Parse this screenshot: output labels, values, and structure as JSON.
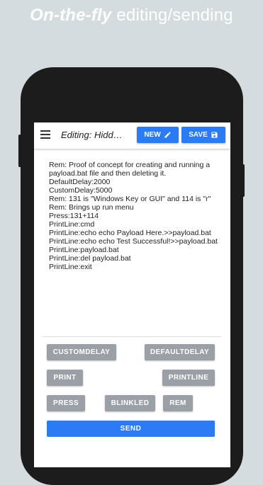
{
  "promo": {
    "bold_text": "On-the-fly",
    "light_text": " editing/sending"
  },
  "app_bar": {
    "menu_icon": "hamburger-menu-icon",
    "title": "Editing: Hidd…",
    "new_label": "NEW",
    "new_icon": "pencil-icon",
    "save_label": "SAVE",
    "save_icon": "floppy-disk-icon",
    "accent_color": "#2b7cf4"
  },
  "script_text": "Rem: Proof of concept for creating and running a payload.bat file and then deleting it.\nDefaultDelay:2000\nCustomDelay:5000\nRem: 131 is \"Windows Key or GUI\" and 114 is \"r\"\nRem: Brings up run menu\nPress:131+114\nPrintLine:cmd\nPrintLine:echo echo Payload Here.>>payload.bat\nPrintLine:echo echo Test Successful!>>payload.bat\nPrintLine:payload.bat\nPrintLine:del payload.bat\nPrintLine:exit",
  "commands": {
    "customdelay": "CUSTOMDELAY",
    "defaultdelay": "DEFAULTDELAY",
    "print": "PRINT",
    "printline": "PRINTLINE",
    "press": "PRESS",
    "blinkled": "BLINKLED",
    "rem": "REM",
    "send": "SEND"
  },
  "colors": {
    "command_button": "#9aa0a6",
    "background": "#d5dcdf"
  }
}
